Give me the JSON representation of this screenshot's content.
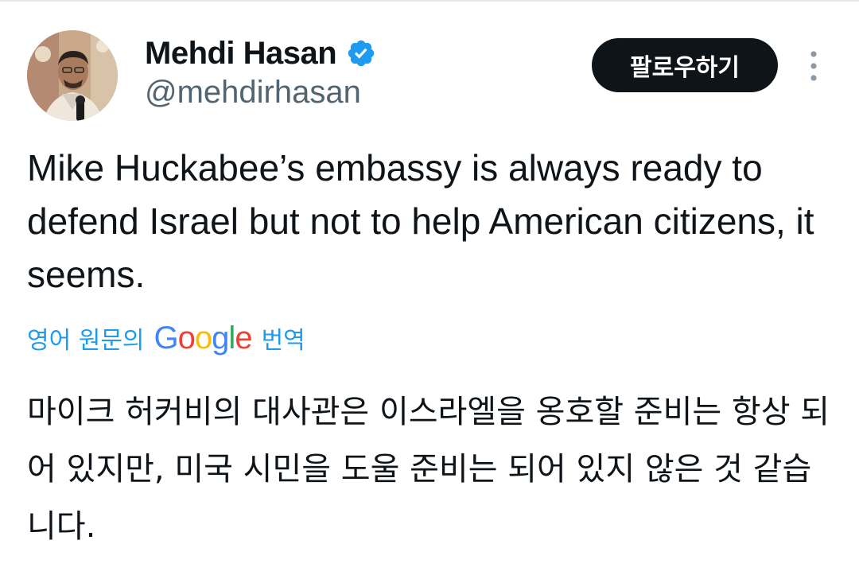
{
  "author": {
    "display_name": "Mehdi Hasan",
    "handle": "@mehdirhasan",
    "verified": true,
    "verified_color": "#1d9bf0",
    "avatar_icon": "profile-photo"
  },
  "actions": {
    "follow_label": "팔로우하기",
    "more_icon": "vertical-ellipsis"
  },
  "tweet": {
    "text": "Mike Huckabee’s embassy is always ready to defend Israel but not to help American citizens, it seems."
  },
  "translation": {
    "prefix": "영어 원문의",
    "provider": "Google",
    "suffix": "번역",
    "link_color": "#1d9bf0",
    "text": "마이크 허커비의 대사관은 이스라엘을 옹호할 준비는 항상 되어 있지만, 미국 시민을 도울 준비는 되어 있지 않은 것 같습니다."
  }
}
